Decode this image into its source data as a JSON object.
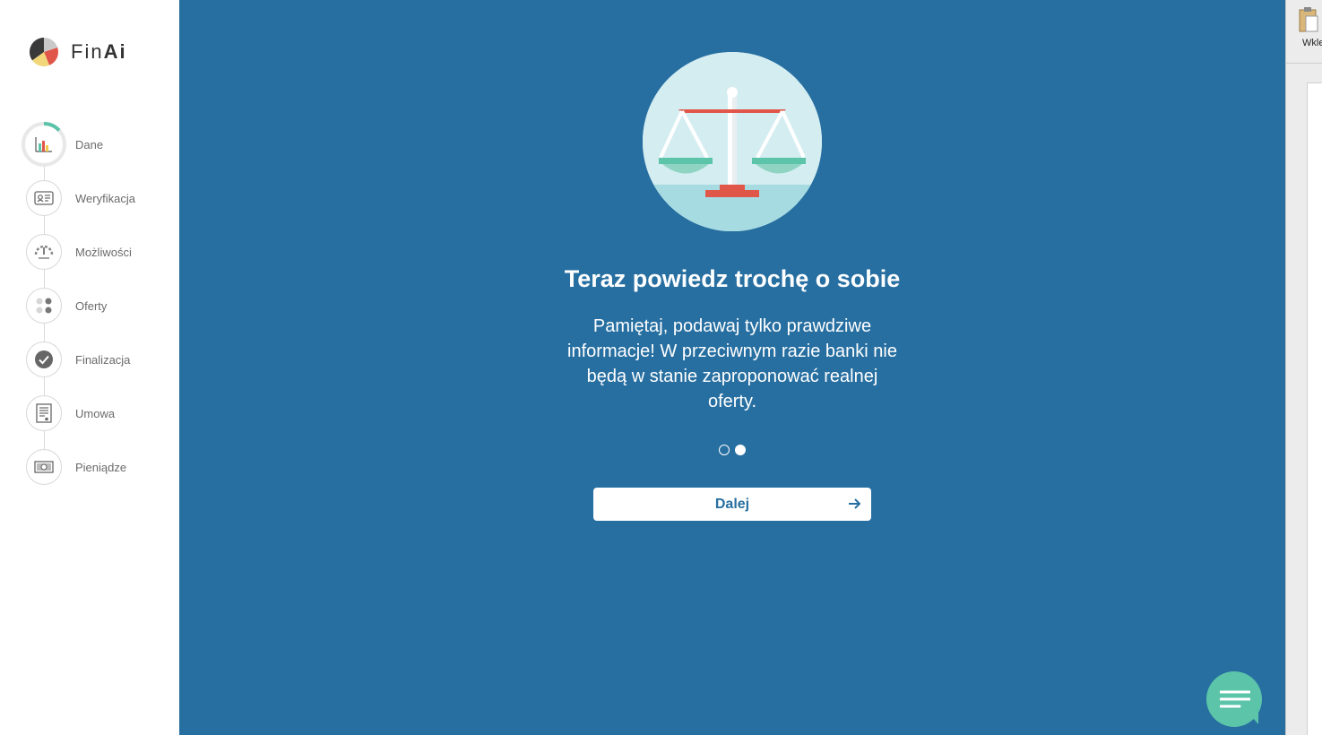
{
  "app": {
    "brand_light": "Fin",
    "brand_bold": "Ai"
  },
  "steps": [
    {
      "label": "Dane",
      "icon": "bar-chart-icon",
      "active": true
    },
    {
      "label": "Weryfikacja",
      "icon": "id-card-icon",
      "active": false
    },
    {
      "label": "Możliwości",
      "icon": "gauge-icon",
      "active": false
    },
    {
      "label": "Oferty",
      "icon": "dots-grid-icon",
      "active": false
    },
    {
      "label": "Finalizacja",
      "icon": "check-circle-icon",
      "active": false
    },
    {
      "label": "Umowa",
      "icon": "contract-icon",
      "active": false
    },
    {
      "label": "Pieniądze",
      "icon": "money-icon",
      "active": false
    }
  ],
  "main": {
    "title": "Teraz powiedz trochę o sobie",
    "description": "Pamiętaj, podawaj tylko prawdziwe informacje! W przeciwnym razie banki nie będą w stanie zaproponować realnej oferty.",
    "pagination": {
      "current": 2,
      "total": 2
    },
    "next_button": "Dalej"
  },
  "background_app": {
    "paste_label": "Wkle"
  },
  "colors": {
    "main_bg": "#276fa1",
    "accent_green": "#5cc4a9",
    "scale_red": "#e0574a"
  }
}
